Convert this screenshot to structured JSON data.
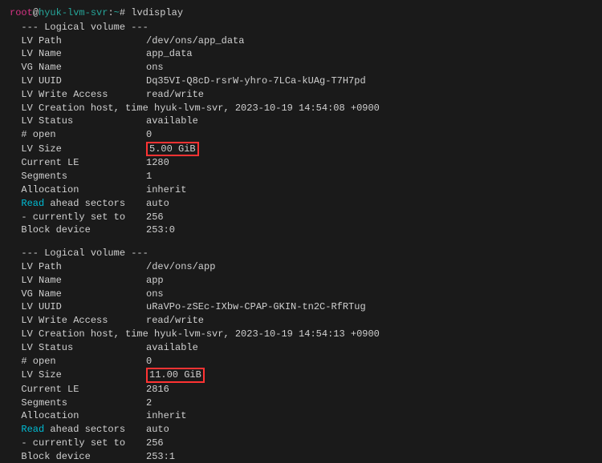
{
  "prompt": {
    "user": "root",
    "host": "hyuk-lvm-svr",
    "path": "~",
    "symbol": "#",
    "command": "lvdisplay"
  },
  "volumes": [
    {
      "header": "  --- Logical volume ---",
      "lv_path": {
        "label": "  LV Path",
        "value": "/dev/ons/app_data"
      },
      "lv_name": {
        "label": "  LV Name",
        "value": "app_data"
      },
      "vg_name": {
        "label": "  VG Name",
        "value": "ons"
      },
      "lv_uuid": {
        "label": "  LV UUID",
        "value": "Dq35VI-Q8cD-rsrW-yhro-7LCa-kUAg-T7H7pd"
      },
      "lv_write": {
        "label": "  LV Write Access",
        "value": "read/write"
      },
      "lv_creation": {
        "label": "  LV Creation host, time ",
        "value": "hyuk-lvm-svr, 2023-10-19 14:54:08 +0900"
      },
      "lv_status": {
        "label": "  LV Status",
        "value": "available"
      },
      "open": {
        "label": "  # open",
        "value": "0"
      },
      "lv_size": {
        "label": "  LV Size",
        "value": "5.00 GiB"
      },
      "current_le": {
        "label": "  Current LE",
        "value": "1280"
      },
      "segments": {
        "label": "  Segments",
        "value": "1"
      },
      "allocation": {
        "label": "  Allocation",
        "value": "inherit"
      },
      "read_ahead": {
        "label_read": "  Read",
        "label_rest": " ahead sectors",
        "value": "auto"
      },
      "currently_set": {
        "label": "  - currently set to",
        "value": "256"
      },
      "block_device": {
        "label": "  Block device",
        "value": "253:0"
      }
    },
    {
      "header": "  --- Logical volume ---",
      "lv_path": {
        "label": "  LV Path",
        "value": "/dev/ons/app"
      },
      "lv_name": {
        "label": "  LV Name",
        "value": "app"
      },
      "vg_name": {
        "label": "  VG Name",
        "value": "ons"
      },
      "lv_uuid": {
        "label": "  LV UUID",
        "value": "uRaVPo-zSEc-IXbw-CPAP-GKIN-tn2C-RfRTug"
      },
      "lv_write": {
        "label": "  LV Write Access",
        "value": "read/write"
      },
      "lv_creation": {
        "label": "  LV Creation host, time ",
        "value": "hyuk-lvm-svr, 2023-10-19 14:54:13 +0900"
      },
      "lv_status": {
        "label": "  LV Status",
        "value": "available"
      },
      "open": {
        "label": "  # open",
        "value": "0"
      },
      "lv_size": {
        "label": "  LV Size",
        "value": "11.00 GiB"
      },
      "current_le": {
        "label": "  Current LE",
        "value": "2816"
      },
      "segments": {
        "label": "  Segments",
        "value": "2"
      },
      "allocation": {
        "label": "  Allocation",
        "value": "inherit"
      },
      "read_ahead": {
        "label_read": "  Read",
        "label_rest": " ahead sectors",
        "value": "auto"
      },
      "currently_set": {
        "label": "  - currently set to",
        "value": "256"
      },
      "block_device": {
        "label": "  Block device",
        "value": "253:1"
      }
    }
  ]
}
